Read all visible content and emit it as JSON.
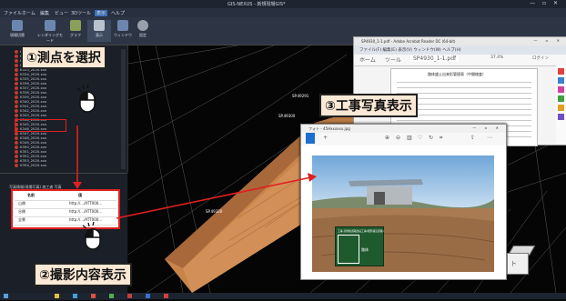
{
  "window": {
    "title": "GIS-NEXUS - 新規現場GIS*"
  },
  "menu": [
    "ファイル",
    "ホーム",
    "編集",
    "ビュー",
    "3Dツール",
    "表示",
    "ヘルプ"
  ],
  "ribbon": [
    "現場切替",
    "レンダリングモード",
    "グラフ",
    "表示",
    "ウィンドウ",
    "設定"
  ],
  "tree_items": [
    "K329_2020.xxx",
    "K330_2020.xxx",
    "K331_2020.xxx",
    "K332_2020.xxx",
    "K333_2020.xxx",
    "K334_2020.xxx",
    "K335_2020.xxx",
    "K336_2020.xxx",
    "K337_2020.xxx",
    "K338_2020.xxx",
    "K339_2020.xxx",
    "K340_2020.xxx",
    "K341_2020.xxx",
    "K342_2020.xxx",
    "K343_2020.xxx",
    "K344_2020.xxx",
    "K345_2020.xxx",
    "K346_2020.xxx",
    "K347_2020.xxx",
    "K348_2020.xxx",
    "K349_2020.xxx",
    "K350_2020.xxx",
    "K351_2020.xxx",
    "K352_2020.xxx",
    "K353_2020.xxx",
    "K354_2020.xxx"
  ],
  "photo_panel": {
    "header": "写真情報(現場写真)  施工者  写真",
    "col1": "名前",
    "col2": "値",
    "rows": [
      [
        "山側",
        "http://.../ATT000..."
      ],
      [
        "谷側",
        "http://.../ATT000..."
      ],
      [
        "全景",
        "http://.../ATT000..."
      ]
    ]
  },
  "callouts": {
    "step1": "①測点を選択",
    "step2": "②撮影内容表示",
    "step3": "③工事写真表示"
  },
  "viewport": {
    "points": [
      "SP.49291",
      "SP.49300",
      "SP.49320"
    ]
  },
  "pdf": {
    "title": "SP4930_1-1.pdf - Adobe Acrobat Reader DC (64-bit)",
    "menu": "ファイル(F)  編集(E)  表示(V)  ウィンドウ(W)  ヘルプ(H)",
    "tab_home": "ホーム",
    "tab_tools": "ツール",
    "tab_file": "SP4930_1-1.pdf",
    "zoom": "37.4%",
    "login": "ログイン",
    "doc_title": "路体盛土出来形管理表（中間検査）"
  },
  "photo_viewer": {
    "title": "フォト - 45Hxxxxxx.jpg",
    "board_title": "工事 高規格道路改良工事(相馬福島道路)",
    "board_field": "路体"
  },
  "colors": {
    "callout_bg": "#fbe9d6",
    "highlight": "#e02020",
    "embankment": "#c9844a"
  }
}
